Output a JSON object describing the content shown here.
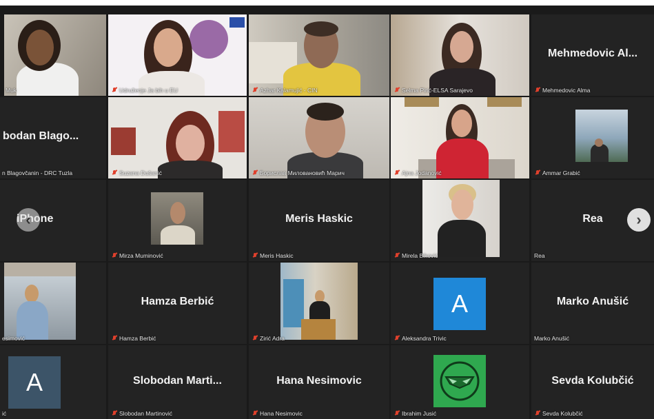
{
  "meeting": {
    "tiles": [
      {
        "id": "r1c1",
        "label": "Muk",
        "big_name": "",
        "muted": false,
        "type": "video"
      },
      {
        "id": "r1c2",
        "label": "Udruženje Ja bih u EU",
        "big_name": "",
        "muted": true,
        "type": "video"
      },
      {
        "id": "r1c3",
        "label": "Azhar Kalamujić - CIN",
        "big_name": "",
        "muted": true,
        "type": "video"
      },
      {
        "id": "r1c4",
        "label": "Selma Pirić-ELSA Sarajevo",
        "big_name": "",
        "muted": true,
        "type": "video"
      },
      {
        "id": "r1c5",
        "label": "Mehmedovic Alma",
        "big_name": "Mehmedovic  Al...",
        "muted": true,
        "type": "name"
      },
      {
        "id": "r2c1",
        "label": "n Blagovčanin - DRC Tuzla",
        "big_name": "bodan  Blago...",
        "muted": false,
        "type": "name"
      },
      {
        "id": "r2c2",
        "label": "Suzana Dušanić",
        "big_name": "",
        "muted": true,
        "type": "video"
      },
      {
        "id": "r2c3",
        "label": "Борислав Миловановић Марич",
        "big_name": "",
        "muted": true,
        "type": "video"
      },
      {
        "id": "r2c4",
        "label": "Ajna Jodanović",
        "big_name": "",
        "muted": true,
        "type": "video"
      },
      {
        "id": "r2c5",
        "label": "Ammar Grabić",
        "big_name": "",
        "muted": true,
        "type": "video"
      },
      {
        "id": "r3c1",
        "label": "",
        "big_name": "iPhone",
        "muted": false,
        "type": "name"
      },
      {
        "id": "r3c2",
        "label": "Mirza Muminović",
        "big_name": "",
        "muted": true,
        "type": "video"
      },
      {
        "id": "r3c3",
        "label": "Meris Haskic",
        "big_name": "Meris Haskic",
        "muted": true,
        "type": "name"
      },
      {
        "id": "r3c4",
        "label": "Mirela Biković",
        "big_name": "",
        "muted": true,
        "type": "video"
      },
      {
        "id": "r3c5",
        "label": "Rea",
        "big_name": "Rea",
        "muted": false,
        "type": "name"
      },
      {
        "id": "r4c1",
        "label": "esimović",
        "big_name": "",
        "muted": false,
        "type": "video"
      },
      {
        "id": "r4c2",
        "label": "Hamza Berbić",
        "big_name": "Hamza Berbić",
        "muted": true,
        "type": "name"
      },
      {
        "id": "r4c3",
        "label": "Zirić Adra",
        "big_name": "",
        "muted": true,
        "type": "video"
      },
      {
        "id": "r4c4",
        "label": "Aleksandra Trivic",
        "big_name": "",
        "muted": true,
        "type": "avatar",
        "avatar_letter": "A"
      },
      {
        "id": "r4c5",
        "label": "Marko Anušić",
        "big_name": "Marko Anušić",
        "muted": false,
        "type": "name"
      },
      {
        "id": "r5c1",
        "label": "ić",
        "big_name": "",
        "muted": false,
        "type": "avatar",
        "avatar_letter": "A"
      },
      {
        "id": "r5c2",
        "label": "Slobodan Martinović",
        "big_name": "Slobodan  Marti...",
        "muted": true,
        "type": "name"
      },
      {
        "id": "r5c3",
        "label": "Hana Nesimovic",
        "big_name": "Hana Nesimovic",
        "muted": true,
        "type": "name"
      },
      {
        "id": "r5c4",
        "label": "Ibrahim Jusić",
        "big_name": "",
        "muted": true,
        "type": "avatar-logo"
      },
      {
        "id": "r5c5",
        "label": "Sevda Kolubčić",
        "big_name": "Sevda Kolubčić",
        "muted": true,
        "type": "name"
      }
    ],
    "nav": {
      "prev_icon": "‹",
      "next_icon": "›"
    },
    "colors": {
      "avatar_blue": "#1f88d8",
      "avatar_slate": "#3c5468",
      "logo_green": "#2fa84f",
      "active_border": "#e0d94a",
      "mute_red": "#e0402c"
    }
  }
}
